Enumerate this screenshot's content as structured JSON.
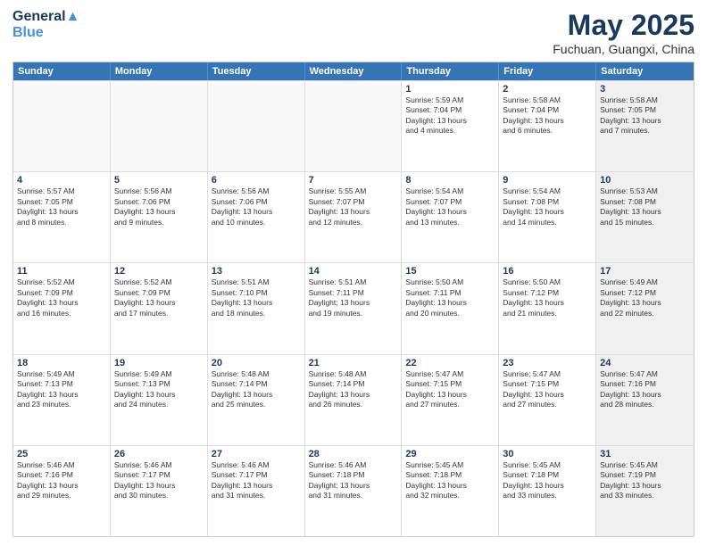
{
  "header": {
    "logo_general": "General",
    "logo_blue": "Blue",
    "month_title": "May 2025",
    "subtitle": "Fuchuan, Guangxi, China"
  },
  "weekdays": [
    "Sunday",
    "Monday",
    "Tuesday",
    "Wednesday",
    "Thursday",
    "Friday",
    "Saturday"
  ],
  "weeks": [
    [
      {
        "day": "",
        "info": "",
        "empty": true
      },
      {
        "day": "",
        "info": "",
        "empty": true
      },
      {
        "day": "",
        "info": "",
        "empty": true
      },
      {
        "day": "",
        "info": "",
        "empty": true
      },
      {
        "day": "1",
        "info": "Sunrise: 5:59 AM\nSunset: 7:04 PM\nDaylight: 13 hours\nand 4 minutes."
      },
      {
        "day": "2",
        "info": "Sunrise: 5:58 AM\nSunset: 7:04 PM\nDaylight: 13 hours\nand 6 minutes."
      },
      {
        "day": "3",
        "info": "Sunrise: 5:58 AM\nSunset: 7:05 PM\nDaylight: 13 hours\nand 7 minutes.",
        "shaded": true
      }
    ],
    [
      {
        "day": "4",
        "info": "Sunrise: 5:57 AM\nSunset: 7:05 PM\nDaylight: 13 hours\nand 8 minutes."
      },
      {
        "day": "5",
        "info": "Sunrise: 5:56 AM\nSunset: 7:06 PM\nDaylight: 13 hours\nand 9 minutes."
      },
      {
        "day": "6",
        "info": "Sunrise: 5:56 AM\nSunset: 7:06 PM\nDaylight: 13 hours\nand 10 minutes."
      },
      {
        "day": "7",
        "info": "Sunrise: 5:55 AM\nSunset: 7:07 PM\nDaylight: 13 hours\nand 12 minutes."
      },
      {
        "day": "8",
        "info": "Sunrise: 5:54 AM\nSunset: 7:07 PM\nDaylight: 13 hours\nand 13 minutes."
      },
      {
        "day": "9",
        "info": "Sunrise: 5:54 AM\nSunset: 7:08 PM\nDaylight: 13 hours\nand 14 minutes."
      },
      {
        "day": "10",
        "info": "Sunrise: 5:53 AM\nSunset: 7:08 PM\nDaylight: 13 hours\nand 15 minutes.",
        "shaded": true
      }
    ],
    [
      {
        "day": "11",
        "info": "Sunrise: 5:52 AM\nSunset: 7:09 PM\nDaylight: 13 hours\nand 16 minutes."
      },
      {
        "day": "12",
        "info": "Sunrise: 5:52 AM\nSunset: 7:09 PM\nDaylight: 13 hours\nand 17 minutes."
      },
      {
        "day": "13",
        "info": "Sunrise: 5:51 AM\nSunset: 7:10 PM\nDaylight: 13 hours\nand 18 minutes."
      },
      {
        "day": "14",
        "info": "Sunrise: 5:51 AM\nSunset: 7:11 PM\nDaylight: 13 hours\nand 19 minutes."
      },
      {
        "day": "15",
        "info": "Sunrise: 5:50 AM\nSunset: 7:11 PM\nDaylight: 13 hours\nand 20 minutes."
      },
      {
        "day": "16",
        "info": "Sunrise: 5:50 AM\nSunset: 7:12 PM\nDaylight: 13 hours\nand 21 minutes."
      },
      {
        "day": "17",
        "info": "Sunrise: 5:49 AM\nSunset: 7:12 PM\nDaylight: 13 hours\nand 22 minutes.",
        "shaded": true
      }
    ],
    [
      {
        "day": "18",
        "info": "Sunrise: 5:49 AM\nSunset: 7:13 PM\nDaylight: 13 hours\nand 23 minutes."
      },
      {
        "day": "19",
        "info": "Sunrise: 5:49 AM\nSunset: 7:13 PM\nDaylight: 13 hours\nand 24 minutes."
      },
      {
        "day": "20",
        "info": "Sunrise: 5:48 AM\nSunset: 7:14 PM\nDaylight: 13 hours\nand 25 minutes."
      },
      {
        "day": "21",
        "info": "Sunrise: 5:48 AM\nSunset: 7:14 PM\nDaylight: 13 hours\nand 26 minutes."
      },
      {
        "day": "22",
        "info": "Sunrise: 5:47 AM\nSunset: 7:15 PM\nDaylight: 13 hours\nand 27 minutes."
      },
      {
        "day": "23",
        "info": "Sunrise: 5:47 AM\nSunset: 7:15 PM\nDaylight: 13 hours\nand 27 minutes."
      },
      {
        "day": "24",
        "info": "Sunrise: 5:47 AM\nSunset: 7:16 PM\nDaylight: 13 hours\nand 28 minutes.",
        "shaded": true
      }
    ],
    [
      {
        "day": "25",
        "info": "Sunrise: 5:46 AM\nSunset: 7:16 PM\nDaylight: 13 hours\nand 29 minutes."
      },
      {
        "day": "26",
        "info": "Sunrise: 5:46 AM\nSunset: 7:17 PM\nDaylight: 13 hours\nand 30 minutes."
      },
      {
        "day": "27",
        "info": "Sunrise: 5:46 AM\nSunset: 7:17 PM\nDaylight: 13 hours\nand 31 minutes."
      },
      {
        "day": "28",
        "info": "Sunrise: 5:46 AM\nSunset: 7:18 PM\nDaylight: 13 hours\nand 31 minutes."
      },
      {
        "day": "29",
        "info": "Sunrise: 5:45 AM\nSunset: 7:18 PM\nDaylight: 13 hours\nand 32 minutes."
      },
      {
        "day": "30",
        "info": "Sunrise: 5:45 AM\nSunset: 7:18 PM\nDaylight: 13 hours\nand 33 minutes."
      },
      {
        "day": "31",
        "info": "Sunrise: 5:45 AM\nSunset: 7:19 PM\nDaylight: 13 hours\nand 33 minutes.",
        "shaded": true
      }
    ]
  ]
}
